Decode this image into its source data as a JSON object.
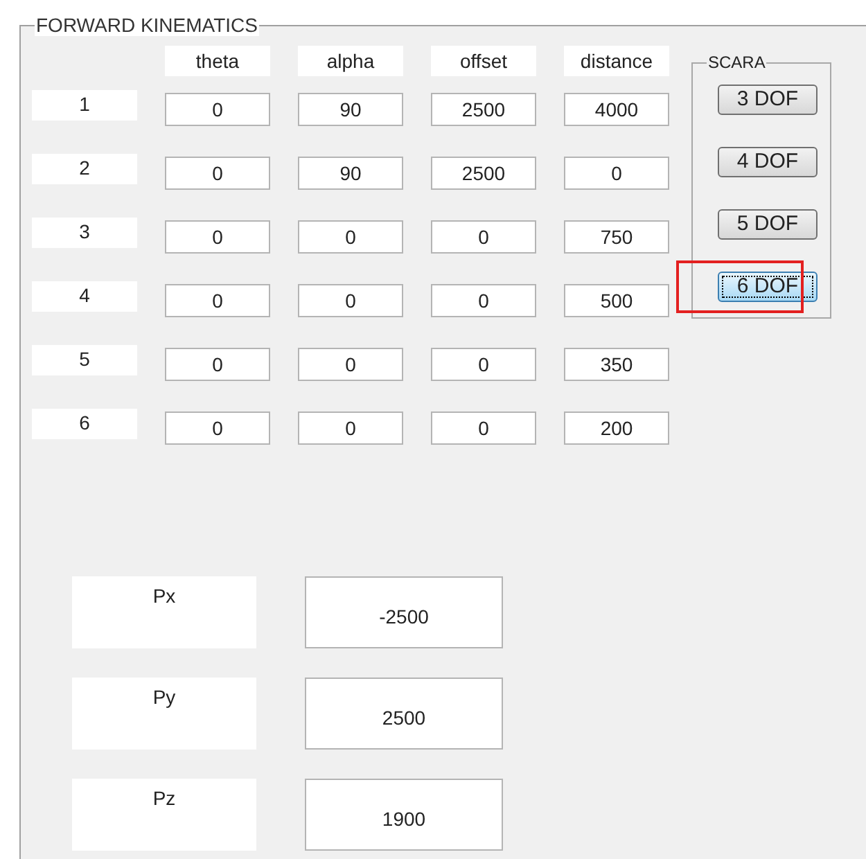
{
  "panel": {
    "title": "FORWARD KINEMATICS"
  },
  "columns": [
    "theta",
    "alpha",
    "offset",
    "distance"
  ],
  "rows": [
    {
      "label": "1",
      "values": [
        "0",
        "90",
        "2500",
        "4000"
      ]
    },
    {
      "label": "2",
      "values": [
        "0",
        "90",
        "2500",
        "0"
      ]
    },
    {
      "label": "3",
      "values": [
        "0",
        "0",
        "0",
        "750"
      ]
    },
    {
      "label": "4",
      "values": [
        "0",
        "0",
        "0",
        "500"
      ]
    },
    {
      "label": "5",
      "values": [
        "0",
        "0",
        "0",
        "350"
      ]
    },
    {
      "label": "6",
      "values": [
        "0",
        "0",
        "0",
        "200"
      ]
    }
  ],
  "scara": {
    "title": "SCARA",
    "buttons": [
      {
        "label": "3 DOF",
        "selected": false
      },
      {
        "label": "4 DOF",
        "selected": false
      },
      {
        "label": "5 DOF",
        "selected": false
      },
      {
        "label": "6 DOF",
        "selected": true
      }
    ]
  },
  "outputs": [
    {
      "label": "Px",
      "value": "-2500"
    },
    {
      "label": "Py",
      "value": "2500"
    },
    {
      "label": "Pz",
      "value": "1900"
    }
  ]
}
